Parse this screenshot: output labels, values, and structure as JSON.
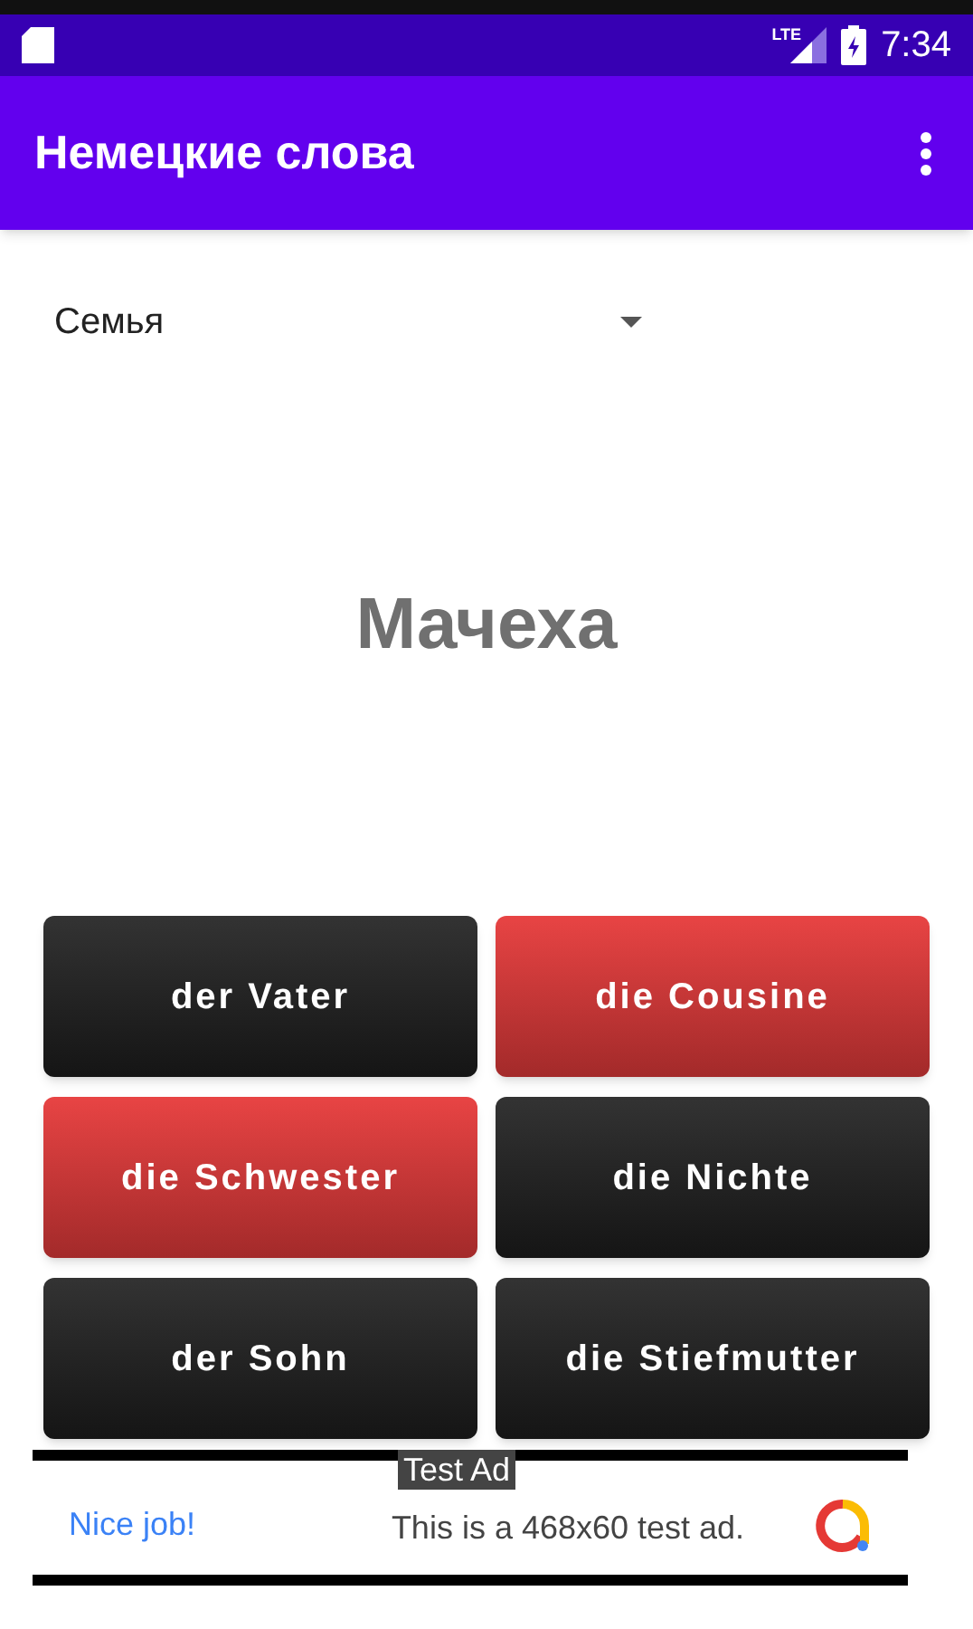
{
  "status_bar": {
    "time": "7:34",
    "network": "LTE"
  },
  "app_bar": {
    "title": "Немецкие слова"
  },
  "category_dropdown": {
    "value": "Семья"
  },
  "word": "Мачеха",
  "answers": [
    {
      "label": "der Vater",
      "wrong": false
    },
    {
      "label": "die Cousine",
      "wrong": true
    },
    {
      "label": "die Schwester",
      "wrong": true
    },
    {
      "label": "die Nichte",
      "wrong": false
    },
    {
      "label": "der Sohn",
      "wrong": false
    },
    {
      "label": "die Stiefmutter",
      "wrong": false
    }
  ],
  "ad": {
    "badge": "Test Ad",
    "headline": "Nice job!",
    "text": "This is a 468x60 test ad."
  }
}
